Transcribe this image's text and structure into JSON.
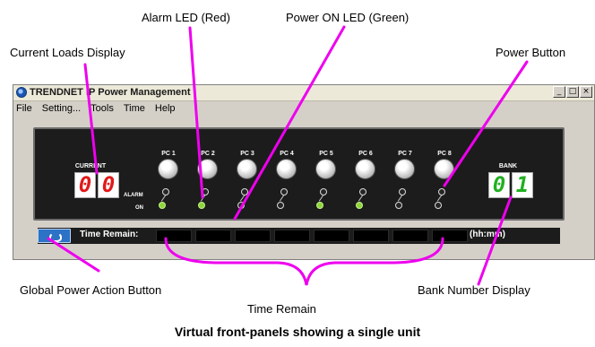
{
  "callouts": {
    "alarm_led": "Alarm LED (Red)",
    "power_on_led": "Power ON LED (Green)",
    "current_loads": "Current Loads Display",
    "power_button": "Power Button",
    "global_power": "Global Power Action Button",
    "bank_number": "Bank Number Display",
    "time_remain": "Time Remain"
  },
  "caption": "Virtual front-panels showing a single unit",
  "window": {
    "title": "TRENDNET IP Power Management",
    "menu": [
      "File",
      "Setting...",
      "Tools",
      "Time",
      "Help"
    ],
    "controls": [
      "_",
      "□",
      "×"
    ]
  },
  "panel": {
    "current_label": "CURRENT",
    "current_digits": [
      "0",
      "0"
    ],
    "alarm_label": "ALARM",
    "on_label": "ON",
    "bank_label": "BANK",
    "bank_digits": [
      "0",
      "1"
    ],
    "time_remain_label": "Time Remain:",
    "time_unit_label": "(hh:mm)",
    "outlets": [
      {
        "label": "PC 1",
        "on": true
      },
      {
        "label": "PC 2",
        "on": true
      },
      {
        "label": "PC 3",
        "on": false
      },
      {
        "label": "PC 4",
        "on": false
      },
      {
        "label": "PC 5",
        "on": true
      },
      {
        "label": "PC 6",
        "on": true
      },
      {
        "label": "PC 7",
        "on": false
      },
      {
        "label": "PC 8",
        "on": false
      }
    ]
  },
  "colors": {
    "callout_line": "#ee00ee",
    "digit_current": "#e11a1a",
    "digit_bank": "#21b021",
    "led_on": "#8fd63a"
  }
}
